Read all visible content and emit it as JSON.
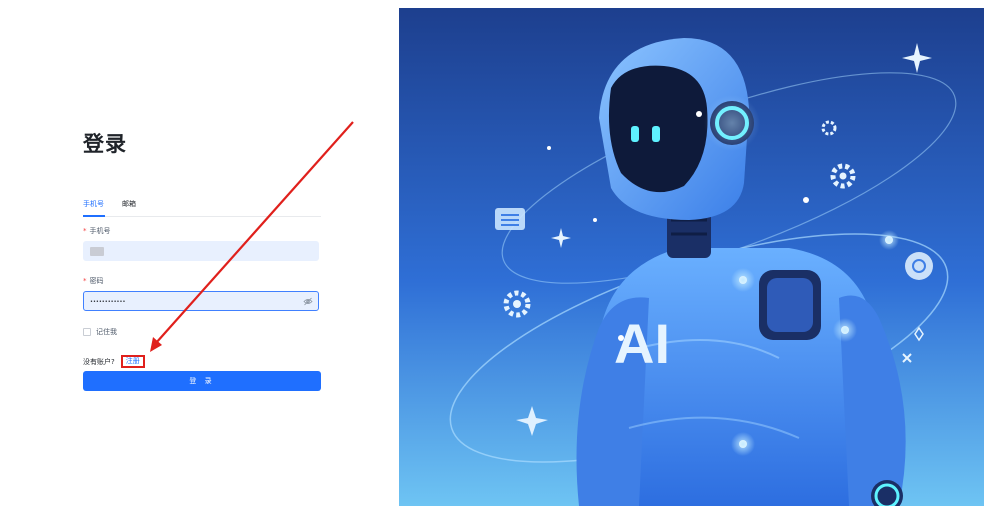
{
  "login": {
    "title": "登录",
    "tabs": [
      {
        "label": "手机号",
        "active": true
      },
      {
        "label": "邮箱",
        "active": false
      }
    ],
    "phone_label": "手机号",
    "password_label": "密码",
    "password_value": "••••••••••••",
    "remember_label": "记住我",
    "no_account_text": "没有账户?",
    "register_link": "注册",
    "login_button": "登 录"
  },
  "hero": {
    "badge_text": "AI"
  },
  "colors": {
    "accent": "#1f6fff",
    "annotation_red": "#e0201c",
    "input_bg": "#e8f0fe"
  }
}
